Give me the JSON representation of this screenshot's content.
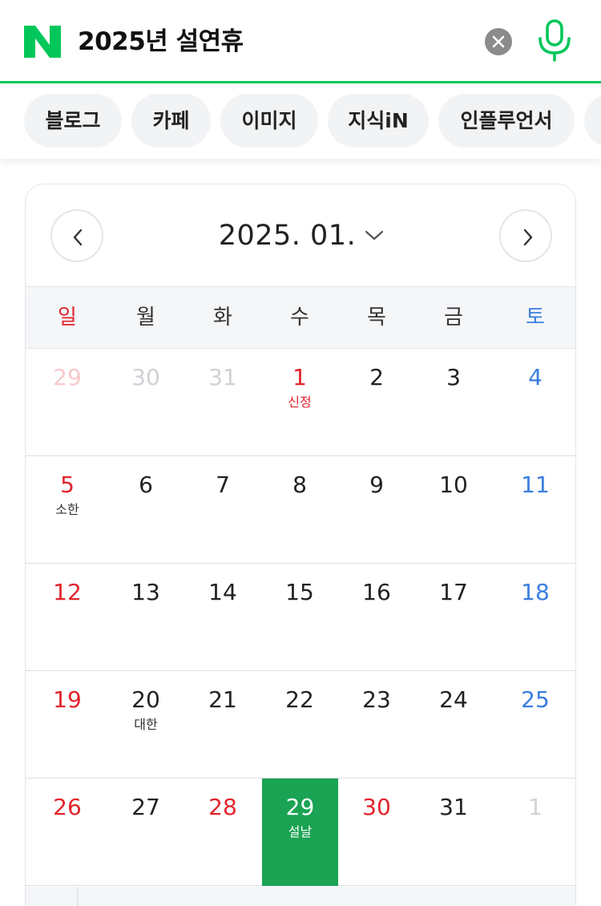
{
  "search": {
    "query": "2025년 설연휴",
    "logo_label": "N",
    "clear_icon": "close-icon",
    "mic_icon": "microphone-icon"
  },
  "tabs": [
    "블로그",
    "카페",
    "이미지",
    "지식iN",
    "인플루언서"
  ],
  "calendar": {
    "month_label": "2025. 01.",
    "weekdays": [
      "일",
      "월",
      "화",
      "수",
      "목",
      "금",
      "토"
    ],
    "weeks": [
      [
        {
          "d": "29",
          "note": ""
        },
        {
          "d": "30",
          "note": ""
        },
        {
          "d": "31",
          "note": ""
        },
        {
          "d": "1",
          "note": "신정"
        },
        {
          "d": "2",
          "note": ""
        },
        {
          "d": "3",
          "note": ""
        },
        {
          "d": "4",
          "note": ""
        }
      ],
      [
        {
          "d": "5",
          "note": "소한"
        },
        {
          "d": "6",
          "note": ""
        },
        {
          "d": "7",
          "note": ""
        },
        {
          "d": "8",
          "note": ""
        },
        {
          "d": "9",
          "note": ""
        },
        {
          "d": "10",
          "note": ""
        },
        {
          "d": "11",
          "note": ""
        }
      ],
      [
        {
          "d": "12",
          "note": ""
        },
        {
          "d": "13",
          "note": ""
        },
        {
          "d": "14",
          "note": ""
        },
        {
          "d": "15",
          "note": ""
        },
        {
          "d": "16",
          "note": ""
        },
        {
          "d": "17",
          "note": ""
        },
        {
          "d": "18",
          "note": ""
        }
      ],
      [
        {
          "d": "19",
          "note": ""
        },
        {
          "d": "20",
          "note": "대한"
        },
        {
          "d": "21",
          "note": ""
        },
        {
          "d": "22",
          "note": ""
        },
        {
          "d": "23",
          "note": ""
        },
        {
          "d": "24",
          "note": ""
        },
        {
          "d": "25",
          "note": ""
        }
      ],
      [
        {
          "d": "26",
          "note": ""
        },
        {
          "d": "27",
          "note": ""
        },
        {
          "d": "28",
          "note": ""
        },
        {
          "d": "29",
          "note": "설날"
        },
        {
          "d": "30",
          "note": ""
        },
        {
          "d": "31",
          "note": ""
        },
        {
          "d": "1",
          "note": ""
        }
      ]
    ],
    "colors": {
      "brand_green": "#03c75a",
      "selected_bg": "#1aa353",
      "sunday_red": "#e1242c",
      "saturday_blue": "#3a7ee0"
    }
  }
}
